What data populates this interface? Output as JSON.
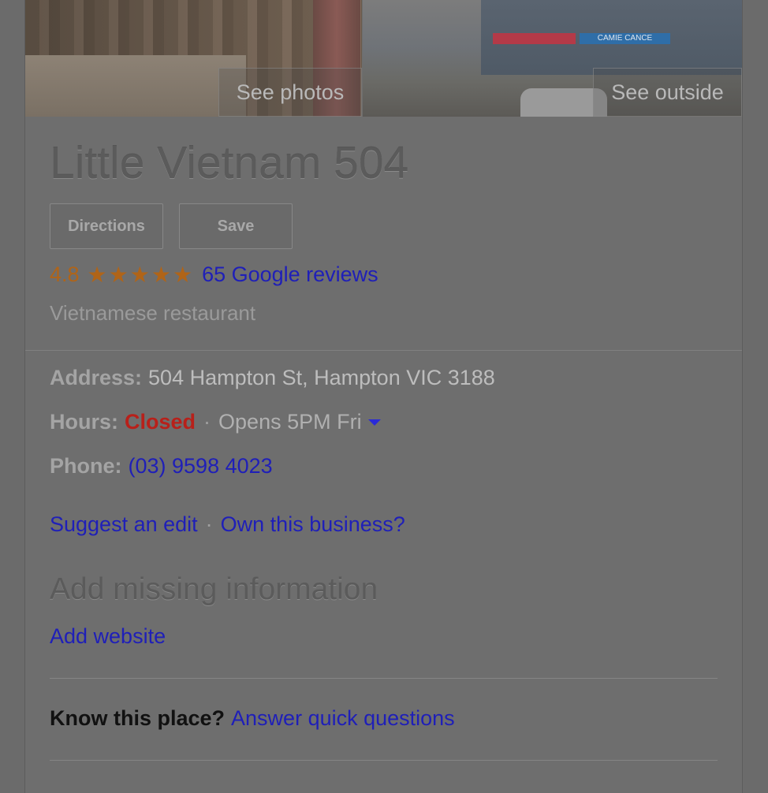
{
  "photos": {
    "see_photos_label": "See photos",
    "see_outside_label": "See outside",
    "sign_text": "CAMIE CANCE"
  },
  "place": {
    "name": "Little Vietnam 504",
    "rating": "4.8",
    "stars": "★★★★★",
    "reviews_link": "65 Google reviews",
    "category": "Vietnamese restaurant"
  },
  "actions": {
    "directions_label": "Directions",
    "save_label": "Save"
  },
  "info": {
    "address_label": "Address:",
    "address_value": "504 Hampton St, Hampton VIC 3188",
    "hours_label": "Hours:",
    "hours_status": "Closed",
    "hours_separator": "·",
    "hours_next": "Opens 5PM Fri",
    "phone_label": "Phone:",
    "phone_value": "(03) 9598 4023"
  },
  "links": {
    "suggest_edit": "Suggest an edit",
    "separator": "·",
    "own_business": "Own this business?"
  },
  "missing": {
    "title": "Add missing information",
    "add_website": "Add website"
  },
  "know": {
    "label": "Know this place?",
    "answer_link": "Answer quick questions"
  },
  "colors": {
    "link": "#1f1fb8",
    "rating": "#b06418",
    "closed": "#b8201a"
  },
  "icons": {
    "rating_stars": "star-icon",
    "hours_dropdown": "caret-down-icon"
  }
}
